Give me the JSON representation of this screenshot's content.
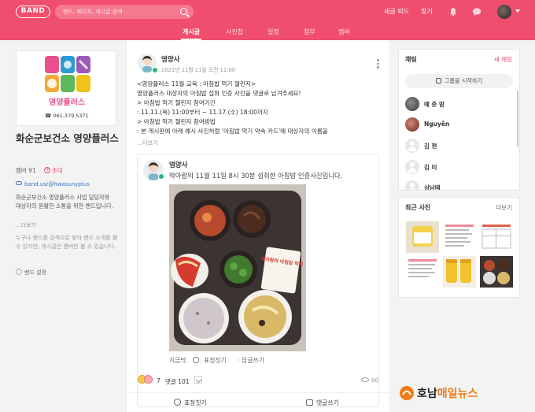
{
  "header": {
    "logo": "BAND",
    "search_placeholder": "밴드, 페이지, 게시글 검색",
    "links": [
      "새글 피드",
      "찾기"
    ],
    "tabs": [
      "게시글",
      "사진첩",
      "일정",
      "첨부",
      "멤버"
    ],
    "active_tab": "게시글"
  },
  "sidebar": {
    "cover_brand": "영양플러스",
    "cover_phone": "☎ 061.379.5371",
    "band_name": "화순군보건소 영양플러스",
    "members": "멤버 91",
    "invite": "초대",
    "url": "band.us/@hwasunyplus",
    "description": "화순군보건소 영양플러스 사업 담당자와 대상자의 원활한 소통을 위한 밴드입니다.",
    "more": "...더보기",
    "notice": "누구나 밴드를 검색으로 찾아 밴드 소개를 볼 수 있지만, 게시글은 멤버만 볼 수 있습니다.",
    "settings": "밴드 설정"
  },
  "post": {
    "author": "영양사",
    "date": "2021년 11월 11일 오전 11:00",
    "lines": [
      "<영양플러스 11월 교육 : 아침밥 먹기 챌린지>",
      "영양플러스 대상자의 아침밥 섭취 인증 사진을 댓글로 남겨주세요!",
      "> 아침밥 먹기 챌린지 참여기간",
      " : 11.11.(목) 11:00부터 ~ 11.17.(수) 18:00까지",
      "> 아침밥 먹기 챌린지 참여방법",
      ": 본 게시판에 아래 예시 사진처럼 '아침밥 먹기 약속 카드'에 대상자의 이름을"
    ],
    "more": "...더보기",
    "comment": {
      "author": "영양사",
      "text": "박아람의 11월 11일 8시 30분 섭취한 아침밥 인증사진입니다.",
      "card_text": "박아람의 아침밥 먹기",
      "actions": [
        "지금막",
        "표정짓기",
        "답글쓰기"
      ]
    },
    "emoji_count": "7",
    "comments_label": "댓글 101",
    "views": "60",
    "bottom_actions": [
      "표정짓기",
      "댓글쓰기"
    ]
  },
  "chat": {
    "title": "채팅",
    "new_chat": "새 채팅",
    "group_button": "그룹을 시작하기",
    "members": [
      "예 준 맘",
      "Nguyễn",
      "김 현",
      "김 미",
      "상남매"
    ]
  },
  "recent": {
    "title": "최근 사진",
    "more": "더보기"
  },
  "footer": {
    "brand_a": "호남",
    "brand_b": "매일뉴스"
  },
  "colors": {
    "brand": "#f04e6e",
    "brand_light": "#f6788f",
    "link": "#3a73c6",
    "footer_accent": "#f07b16"
  },
  "icons": [
    "search-icon",
    "bell-icon",
    "chat-bubble-icon",
    "smile-icon",
    "comment-icon",
    "eye-icon",
    "gear-icon",
    "link-icon",
    "phone-icon",
    "more-kebab-icon"
  ]
}
